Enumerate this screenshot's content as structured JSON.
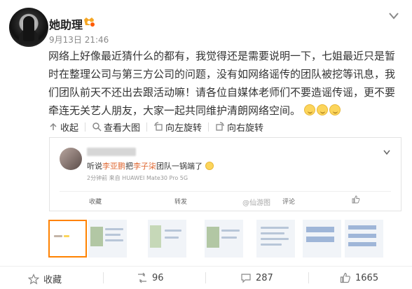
{
  "post": {
    "author": "她助理",
    "time": "9月13日 21:46",
    "text": "网络上好像最近猜什么的都有，我觉得还是需要说明一下，七姐最近只是暂时在整理公司与第三方公司的问题，没有如网络谣传的团队被挖等讯息，我们团队前天不还出去跟活动嘛！请各位自媒体老师们不要造谣传谣，更不要牵连无关艺人朋友，大家一起共同维护清朗网络空间。"
  },
  "toolbar": {
    "collapse": "收起",
    "view_large": "查看大图",
    "rotate_left": "向左旋转",
    "rotate_right": "向右旋转"
  },
  "embedded": {
    "text_a": "听说",
    "name_1": "李亚鹏",
    "text_b": "把",
    "name_2": "李子柒",
    "text_c": "团队一锅端了",
    "meta_time": "2分钟前",
    "meta_source": "来自 HUAWEI Mate30 Pro 5G",
    "action_collect": "收藏",
    "action_repost": "转发",
    "action_comment": "评论",
    "watermark": "@仙游图"
  },
  "actions": {
    "collect": "收藏",
    "repost_count": "96",
    "comment_count": "287",
    "like_count": "1665"
  },
  "colors": {
    "accent_orange": "#ff8200",
    "highlight": "#e06b36",
    "muted": "#888888"
  },
  "icons": [
    "star-icon",
    "share-icon",
    "comment-icon",
    "thumb-up-icon",
    "chevron-down-icon",
    "zoom-icon",
    "rotate-left-icon",
    "rotate-right-icon",
    "collapse-icon"
  ]
}
